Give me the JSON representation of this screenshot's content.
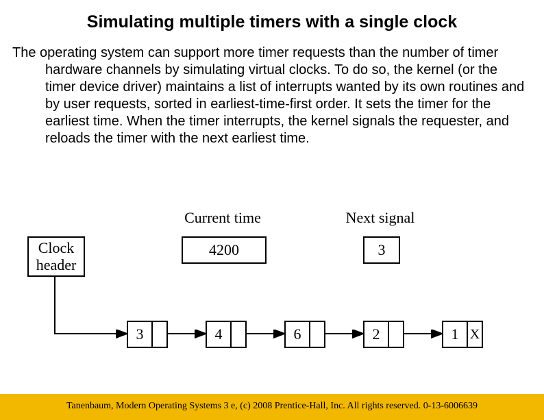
{
  "title": "Simulating multiple timers with a single clock",
  "paragraph": "The operating system can support more timer requests than the number of timer hardware channels by simulating virtual clocks. To do so, the kernel (or the timer device driver) maintains a list of interrupts wanted by its own routines and by user requests, sorted in earliest-time-first order. It sets the timer for the earliest time. When the timer interrupts, the kernel signals the requester, and reloads the timer with the next earliest time.",
  "diagram": {
    "labels": {
      "clock_header": "Clock\nheader",
      "current_time": "Current time",
      "next_signal": "Next signal"
    },
    "current_time_value": "4200",
    "next_signal_value": "3",
    "list": [
      {
        "value": "3",
        "terminator": false
      },
      {
        "value": "4",
        "terminator": false
      },
      {
        "value": "6",
        "terminator": false
      },
      {
        "value": "2",
        "terminator": false
      },
      {
        "value": "1",
        "terminator": true
      }
    ]
  },
  "chart_data": {
    "type": "diagram",
    "current_time": 4200,
    "next_signal": 3,
    "queue_deltas": [
      3,
      4,
      6,
      2,
      1
    ],
    "structure": "Clock header points to linked list of delta-time nodes; X marks list terminator"
  },
  "footer": "Tanenbaum, Modern Operating Systems 3 e, (c) 2008 Prentice-Hall, Inc. All rights reserved. 0-13-6006639"
}
